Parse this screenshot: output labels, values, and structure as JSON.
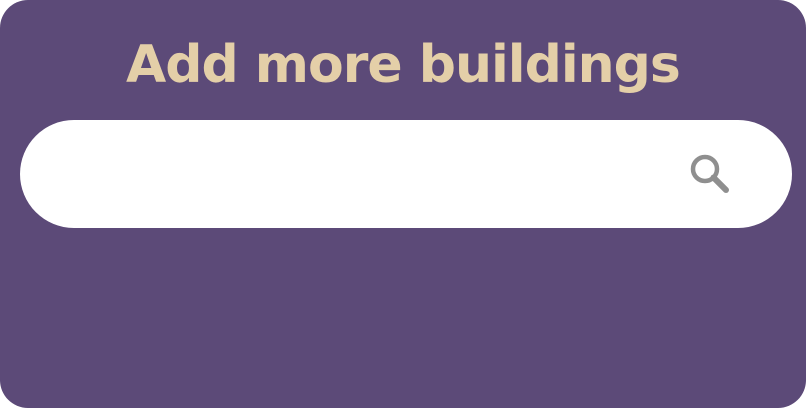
{
  "panel": {
    "title": "Add more buildings"
  },
  "search": {
    "value": "",
    "placeholder": "",
    "icon": "search-icon"
  },
  "colors": {
    "background": "#5c4a78",
    "title": "#e4cfa8",
    "search_bar": "#ffffff",
    "icon": "#8f8f8f"
  }
}
